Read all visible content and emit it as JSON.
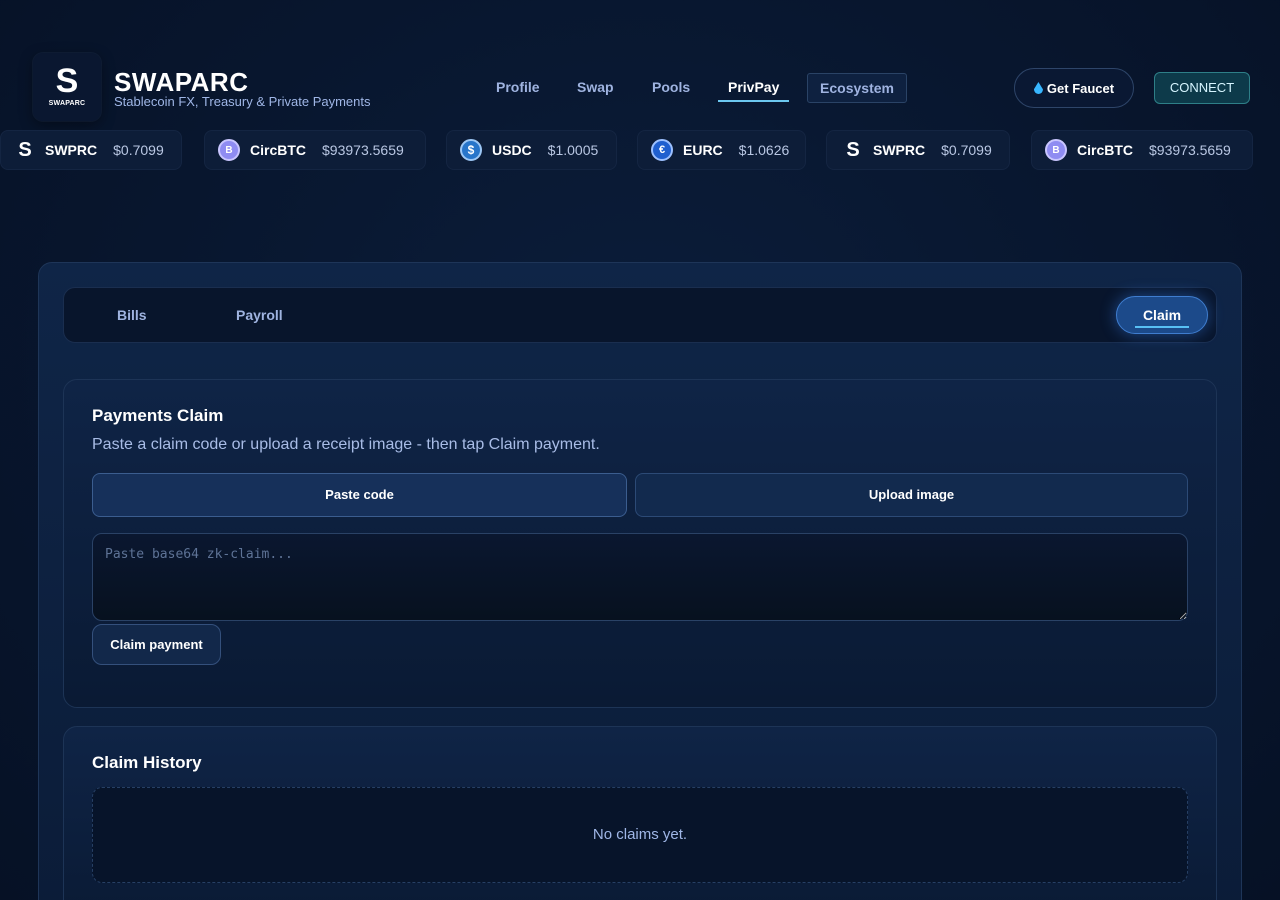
{
  "brand": {
    "logo_letter": "S",
    "logo_word": "SWAPARC",
    "title": "SWAPARC",
    "subtitle": "Stablecoin FX, Treasury & Private Payments"
  },
  "nav": {
    "items": [
      {
        "label": "Profile"
      },
      {
        "label": "Swap"
      },
      {
        "label": "Pools"
      },
      {
        "label": "PrivPay",
        "active": true
      },
      {
        "label": "Ecosystem"
      }
    ],
    "faucet_label": "Get Faucet",
    "connect_label": "CONNECT"
  },
  "ticker": [
    {
      "symbol": "SWPRC",
      "price": "$0.7099",
      "icon": "swprc-icon",
      "glyph": "S"
    },
    {
      "symbol": "CircBTC",
      "price": "$93973.5659",
      "icon": "circbtc-icon",
      "glyph": "B"
    },
    {
      "symbol": "USDC",
      "price": "$1.0005",
      "icon": "usdc-icon",
      "glyph": "$"
    },
    {
      "symbol": "EURC",
      "price": "$1.0626",
      "icon": "eurc-icon",
      "glyph": "€"
    },
    {
      "symbol": "SWPRC",
      "price": "$0.7099",
      "icon": "swprc-icon",
      "glyph": "S"
    },
    {
      "symbol": "CircBTC",
      "price": "$93973.5659",
      "icon": "circbtc-icon",
      "glyph": "B"
    }
  ],
  "tabs": {
    "bills": "Bills",
    "payroll": "Payroll",
    "claim": "Claim",
    "active": "Claim"
  },
  "claim_panel": {
    "title": "Payments Claim",
    "description": "Paste a claim code or upload a receipt image - then tap Claim payment.",
    "paste_button": "Paste code",
    "upload_button": "Upload image",
    "textarea_value": "",
    "textarea_placeholder": "Paste base64 zk-claim...",
    "claim_button": "Claim payment"
  },
  "history_panel": {
    "title": "Claim History",
    "empty_text": "No claims yet."
  },
  "colors": {
    "background": "#08162e",
    "accent": "#58c0f5",
    "active_tab": "#1c4a8a",
    "connect": "#0d3a4a"
  }
}
